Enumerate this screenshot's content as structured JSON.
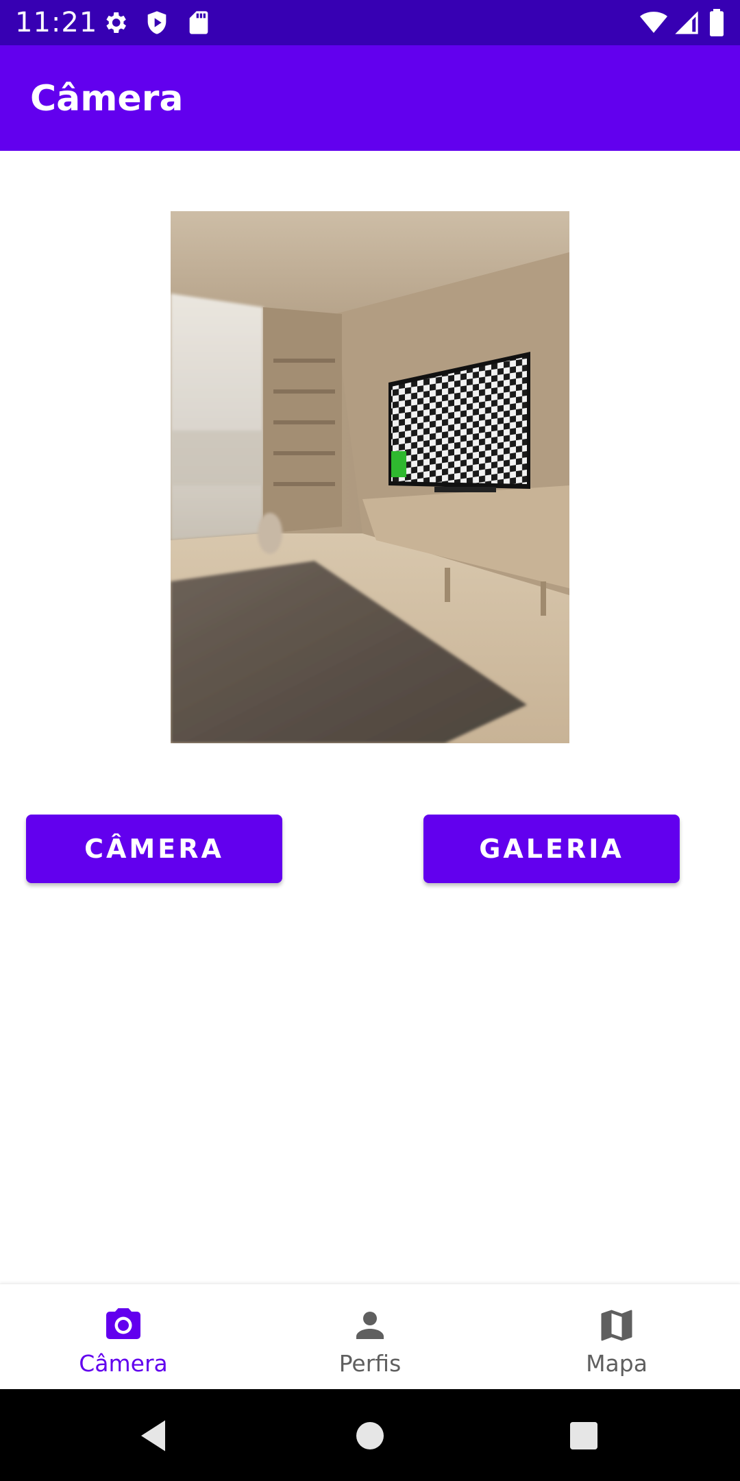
{
  "status_bar": {
    "time": "11:21",
    "left_icons": [
      "gear-icon",
      "shield-icon",
      "sd-card-icon"
    ],
    "right_icons": [
      "wifi-icon",
      "signal-icon",
      "battery-icon"
    ],
    "background": "#3700b3"
  },
  "app_bar": {
    "title": "Câmera",
    "background": "#6200ee"
  },
  "photo": {
    "description_icon": "room-photo-image"
  },
  "buttons": {
    "camera_label": "CÂMERA",
    "gallery_label": "GALERIA",
    "color": "#6200ee"
  },
  "bottom_nav": {
    "items": [
      {
        "label": "Câmera",
        "icon": "camera-icon",
        "active": true
      },
      {
        "label": "Perfis",
        "icon": "person-icon",
        "active": false
      },
      {
        "label": "Mapa",
        "icon": "map-icon",
        "active": false
      }
    ],
    "active_color": "#6200ee",
    "inactive_color": "#5f5f5f"
  },
  "system_nav": {
    "icons": [
      "back-icon",
      "home-icon",
      "recents-icon"
    ]
  }
}
